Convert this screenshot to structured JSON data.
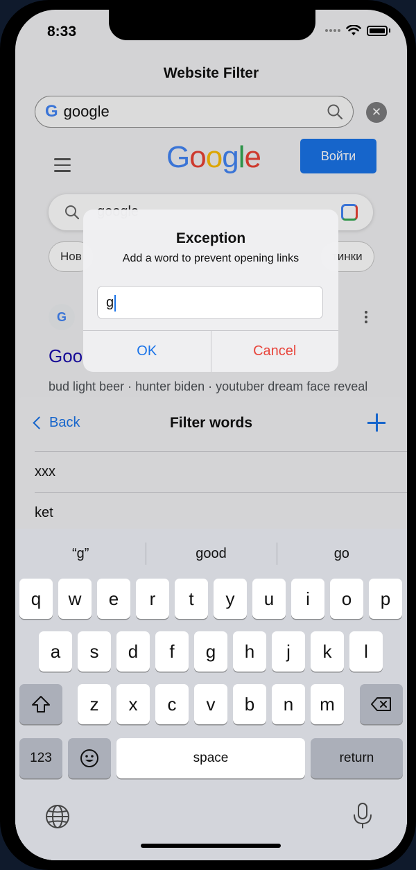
{
  "status": {
    "time": "8:33"
  },
  "app": {
    "title": "Website Filter",
    "url": "google"
  },
  "web": {
    "logo": "Google",
    "login": "Войти",
    "search_value": "google",
    "chips": [
      "Нов",
      "тинки"
    ],
    "result_title": "Goo",
    "result_snippet": "bud light beer · hunter biden · youtuber dream face reveal · black bear in destin florida beach · colin"
  },
  "sheet": {
    "back": "Back",
    "title": "Filter words",
    "words": [
      "xxx",
      "ket"
    ]
  },
  "alert": {
    "title": "Exception",
    "message": "Add a word to prevent opening links",
    "input_value": "g",
    "ok": "OK",
    "cancel": "Cancel"
  },
  "keyboard": {
    "suggestions": [
      "“g”",
      "good",
      "go"
    ],
    "row1": [
      "q",
      "w",
      "e",
      "r",
      "t",
      "y",
      "u",
      "i",
      "o",
      "p"
    ],
    "row2": [
      "a",
      "s",
      "d",
      "f",
      "g",
      "h",
      "j",
      "k",
      "l"
    ],
    "row3": [
      "z",
      "x",
      "c",
      "v",
      "b",
      "n",
      "m"
    ],
    "numbers": "123",
    "space": "space",
    "return": "return"
  },
  "colors": {
    "accent": "#1a73e8",
    "destructive": "#e8453c",
    "keyboard_bg": "#d3d5db"
  },
  "icons": [
    "search-icon",
    "clear-icon",
    "menu-icon",
    "lens-icon",
    "back-chevron-icon",
    "plus-icon",
    "shift-icon",
    "delete-icon",
    "emoji-icon",
    "globe-icon",
    "mic-icon",
    "wifi-icon",
    "battery-icon"
  ]
}
